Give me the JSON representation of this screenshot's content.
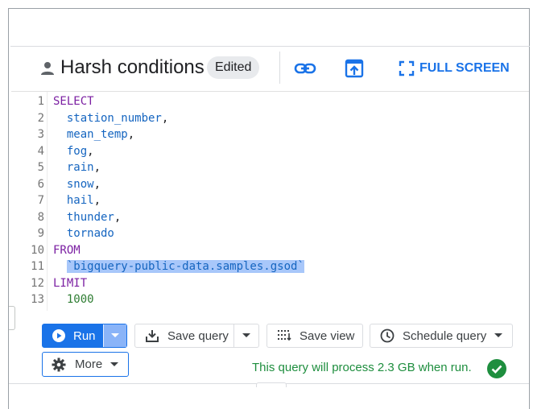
{
  "header": {
    "title": "Harsh conditions",
    "badge": "Edited",
    "fullscreen_label": "FULL SCREEN",
    "icons": [
      "person-icon",
      "link-icon",
      "open-in-new-icon",
      "fullscreen-icon"
    ]
  },
  "editor": {
    "lines": [
      {
        "n": "1",
        "tokens": [
          {
            "t": "SELECT",
            "c": "kw"
          }
        ]
      },
      {
        "n": "2",
        "tokens": [
          {
            "t": "  station_number",
            "c": "id"
          },
          {
            "t": ",",
            "c": "plain"
          }
        ]
      },
      {
        "n": "3",
        "tokens": [
          {
            "t": "  mean_temp",
            "c": "id"
          },
          {
            "t": ",",
            "c": "plain"
          }
        ]
      },
      {
        "n": "4",
        "tokens": [
          {
            "t": "  fog",
            "c": "id"
          },
          {
            "t": ",",
            "c": "plain"
          }
        ]
      },
      {
        "n": "5",
        "tokens": [
          {
            "t": "  rain",
            "c": "id"
          },
          {
            "t": ",",
            "c": "plain"
          }
        ]
      },
      {
        "n": "6",
        "tokens": [
          {
            "t": "  snow",
            "c": "id"
          },
          {
            "t": ",",
            "c": "plain"
          }
        ]
      },
      {
        "n": "7",
        "tokens": [
          {
            "t": "  hail",
            "c": "id"
          },
          {
            "t": ",",
            "c": "plain"
          }
        ]
      },
      {
        "n": "8",
        "tokens": [
          {
            "t": "  thunder",
            "c": "id"
          },
          {
            "t": ",",
            "c": "plain"
          }
        ]
      },
      {
        "n": "9",
        "tokens": [
          {
            "t": "  tornado",
            "c": "id"
          }
        ]
      },
      {
        "n": "10",
        "tokens": [
          {
            "t": "FROM",
            "c": "kw"
          }
        ]
      },
      {
        "n": "11",
        "tokens": [
          {
            "t": "  ",
            "c": "plain"
          },
          {
            "t": "`bigquery-public-data.samples.gsod`",
            "c": "hl"
          }
        ]
      },
      {
        "n": "12",
        "tokens": [
          {
            "t": "LIMIT",
            "c": "kw"
          }
        ]
      },
      {
        "n": "13",
        "tokens": [
          {
            "t": "  1000",
            "c": "num"
          }
        ]
      }
    ]
  },
  "toolbar": {
    "run_label": "Run",
    "save_query_label": "Save query",
    "save_view_label": "Save view",
    "schedule_label": "Schedule query",
    "more_label": "More"
  },
  "status": {
    "message": "This query will process 2.3 GB when run.",
    "state": "valid"
  },
  "colors": {
    "accent": "#1a73e8",
    "success": "#1e8e3e",
    "keyword": "#7b1fa2",
    "identifier": "#1565c0",
    "number": "#2e7d32",
    "selection": "#a8c7fa"
  }
}
